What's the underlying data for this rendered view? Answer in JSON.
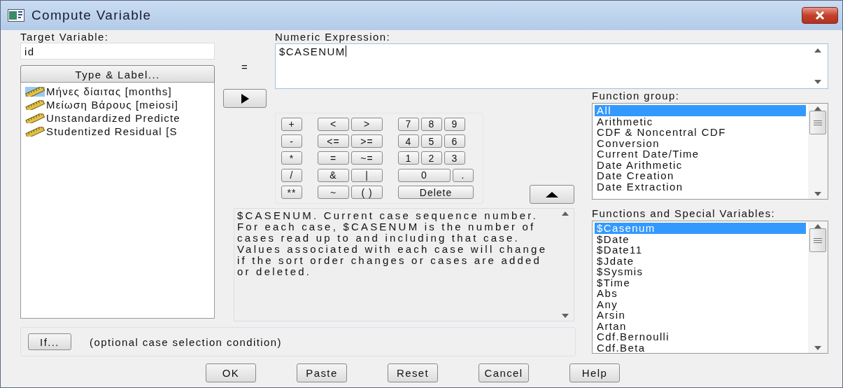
{
  "window": {
    "title": "Compute Variable"
  },
  "target": {
    "label": "Target Variable:",
    "value": "id"
  },
  "equals": "=",
  "type_label_button": "Type & Label...",
  "variables": [
    {
      "name": "Μήνες δίαιτας [months]",
      "selected": true
    },
    {
      "name": "Μείωση Βάρους [meiosi]",
      "selected": false
    },
    {
      "name": "Unstandardized Predicte",
      "selected": false
    },
    {
      "name": "Studentized Residual [S",
      "selected": false
    }
  ],
  "expression": {
    "label": "Numeric Expression:",
    "value": "$CASENUM"
  },
  "keypad": [
    [
      [
        {
          "label": "+",
          "kind": "single"
        }
      ],
      [
        {
          "label": "<",
          "kind": "medium"
        },
        {
          "label": ">",
          "kind": "medium"
        }
      ],
      [
        {
          "label": "7",
          "kind": "single"
        },
        {
          "label": "8",
          "kind": "single"
        },
        {
          "label": "9",
          "kind": "single"
        }
      ]
    ],
    [
      [
        {
          "label": "-",
          "kind": "single"
        }
      ],
      [
        {
          "label": "<=",
          "kind": "medium"
        },
        {
          "label": ">=",
          "kind": "medium"
        }
      ],
      [
        {
          "label": "4",
          "kind": "single"
        },
        {
          "label": "5",
          "kind": "single"
        },
        {
          "label": "6",
          "kind": "single"
        }
      ]
    ],
    [
      [
        {
          "label": "*",
          "kind": "single"
        }
      ],
      [
        {
          "label": "=",
          "kind": "medium"
        },
        {
          "label": "~=",
          "kind": "medium"
        }
      ],
      [
        {
          "label": "1",
          "kind": "single"
        },
        {
          "label": "2",
          "kind": "single"
        },
        {
          "label": "3",
          "kind": "single"
        }
      ]
    ],
    [
      [
        {
          "label": "/",
          "kind": "single"
        }
      ],
      [
        {
          "label": "&",
          "kind": "medium"
        },
        {
          "label": "|",
          "kind": "medium"
        }
      ],
      [
        {
          "label": "0",
          "kind": "double"
        },
        {
          "label": ".",
          "kind": "single"
        }
      ]
    ],
    [
      [
        {
          "label": "**",
          "kind": "single"
        }
      ],
      [
        {
          "label": "~",
          "kind": "medium"
        },
        {
          "label": "( )",
          "kind": "medium"
        }
      ],
      [
        {
          "label": "Delete",
          "kind": "triple"
        }
      ]
    ]
  ],
  "description": "$CASENUM. Current case sequence number. For each case, $CASENUM is the number of cases read up to and including that case. Values associated with each case will change if the sort order changes or cases are added or deleted.",
  "function_group": {
    "label": "Function group:",
    "items": [
      {
        "name": "All",
        "selected": true
      },
      {
        "name": "Arithmetic",
        "selected": false
      },
      {
        "name": "CDF & Noncentral CDF",
        "selected": false
      },
      {
        "name": "Conversion",
        "selected": false
      },
      {
        "name": "Current Date/Time",
        "selected": false
      },
      {
        "name": "Date Arithmetic",
        "selected": false
      },
      {
        "name": "Date Creation",
        "selected": false
      },
      {
        "name": "Date Extraction",
        "selected": false
      }
    ]
  },
  "functions": {
    "label": "Functions and Special Variables:",
    "items": [
      {
        "name": "$Casenum",
        "selected": true
      },
      {
        "name": "$Date",
        "selected": false
      },
      {
        "name": "$Date11",
        "selected": false
      },
      {
        "name": "$Jdate",
        "selected": false
      },
      {
        "name": "$Sysmis",
        "selected": false
      },
      {
        "name": "$Time",
        "selected": false
      },
      {
        "name": "Abs",
        "selected": false
      },
      {
        "name": "Any",
        "selected": false
      },
      {
        "name": "Arsin",
        "selected": false
      },
      {
        "name": "Artan",
        "selected": false
      },
      {
        "name": "Cdf.Bernoulli",
        "selected": false
      },
      {
        "name": "Cdf.Beta",
        "selected": false
      }
    ]
  },
  "if_button": "If...",
  "if_hint": "(optional case selection condition)",
  "buttons": [
    "OK",
    "Paste",
    "Reset",
    "Cancel",
    "Help"
  ]
}
